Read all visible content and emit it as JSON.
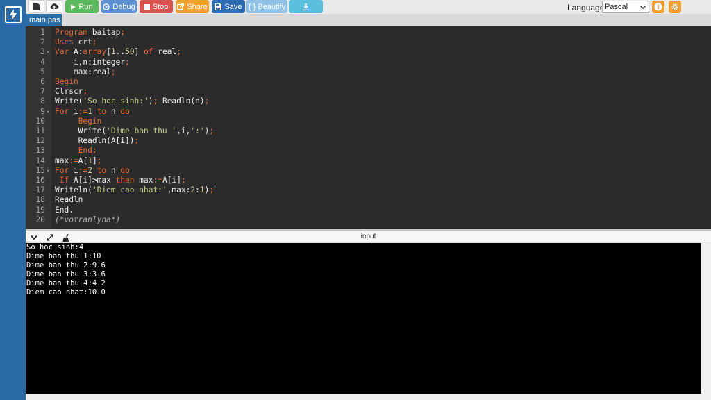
{
  "toolbar": {
    "run_label": "Run",
    "debug_label": "Debug",
    "stop_label": "Stop",
    "share_label": "Share",
    "save_label": "Save",
    "beautify_label": "{ } Beautify",
    "language_label": "Language",
    "language_value": "Pascal",
    "colors": {
      "run": "#5cb85c",
      "debug": "#5b8fcf",
      "stop": "#d9534f",
      "share": "#f0a030",
      "save": "#2d6cb0",
      "beautify": "#8fc2e6",
      "download": "#5bc0de"
    }
  },
  "tabs": [
    {
      "label": "main.pas"
    }
  ],
  "editor": {
    "lines": [
      {
        "n": "1",
        "html": "<span class='kw'>Program</span> baitap<span class='op'>;</span>"
      },
      {
        "n": "2",
        "html": "<span class='kw'>Uses</span> crt<span class='op'>;</span>"
      },
      {
        "n": "3",
        "fold": true,
        "html": "<span class='kw'>Var</span> A:<span class='kw'>array</span>[<span class='num'>1</span>..<span class='num'>50</span>] <span class='kw'>of</span> real<span class='op'>;</span>"
      },
      {
        "n": "4",
        "html": "    i,n:integer<span class='op'>;</span>"
      },
      {
        "n": "5",
        "html": "    max:real<span class='op'>;</span>"
      },
      {
        "n": "6",
        "html": "<span class='kw'>Begin</span>"
      },
      {
        "n": "7",
        "html": "Clrscr<span class='op'>;</span>"
      },
      {
        "n": "8",
        "html": "Write(<span class='str'>'So hoc sinh:'</span>)<span class='op'>;</span> Readln(n)<span class='op'>;</span>"
      },
      {
        "n": "9",
        "fold": true,
        "html": "<span class='kw'>For</span> i<span class='op'>:=</span><span class='num'>1</span> <span class='kw'>to</span> n <span class='kw'>do</span>"
      },
      {
        "n": "10",
        "html": "     <span class='kw'>Begin</span>"
      },
      {
        "n": "11",
        "html": "     Write(<span class='str'>'Dime ban thu '</span>,i,<span class='str'>':'</span>)<span class='op'>;</span>"
      },
      {
        "n": "12",
        "html": "     Readln(A[i])<span class='op'>;</span>"
      },
      {
        "n": "13",
        "html": "     <span class='kw'>End</span><span class='op'>;</span>"
      },
      {
        "n": "14",
        "html": "max<span class='op'>:=</span>A[<span class='num'>1</span>]<span class='op'>;</span>"
      },
      {
        "n": "15",
        "fold": true,
        "html": "<span class='kw'>For</span> i<span class='op'>:=</span><span class='num'>2</span> <span class='kw'>to</span> n <span class='kw'>do</span>"
      },
      {
        "n": "16",
        "html": " <span class='kw'>If</span> A[i]&gt;max <span class='kw'>then</span> max<span class='op'>:=</span>A[i]<span class='op'>;</span>"
      },
      {
        "n": "17",
        "html": "Writeln(<span class='str'>'Diem cao nhat:'</span>,max:<span class='num'>2</span>:<span class='num'>1</span>)<span class='op'>;</span><span class='caret'></span>"
      },
      {
        "n": "18",
        "html": "Readln"
      },
      {
        "n": "19",
        "html": "End."
      },
      {
        "n": "20",
        "html": "<span class='cmt'>(*votranlyna*)</span>"
      }
    ],
    "colors": {
      "background": "#2b2b2c",
      "keyword": "#e06a3a",
      "string": "#c7d28a",
      "number": "#d6cfa0"
    }
  },
  "output_panel": {
    "title": "input",
    "lines": [
      "So hoc sinh:4",
      "Dime ban thu 1:10",
      "Dime ban thu 2:9.6",
      "Dime ban thu 3:3.6",
      "Dime ban thu 4:4.2",
      "Diem cao nhat:10.0"
    ]
  }
}
